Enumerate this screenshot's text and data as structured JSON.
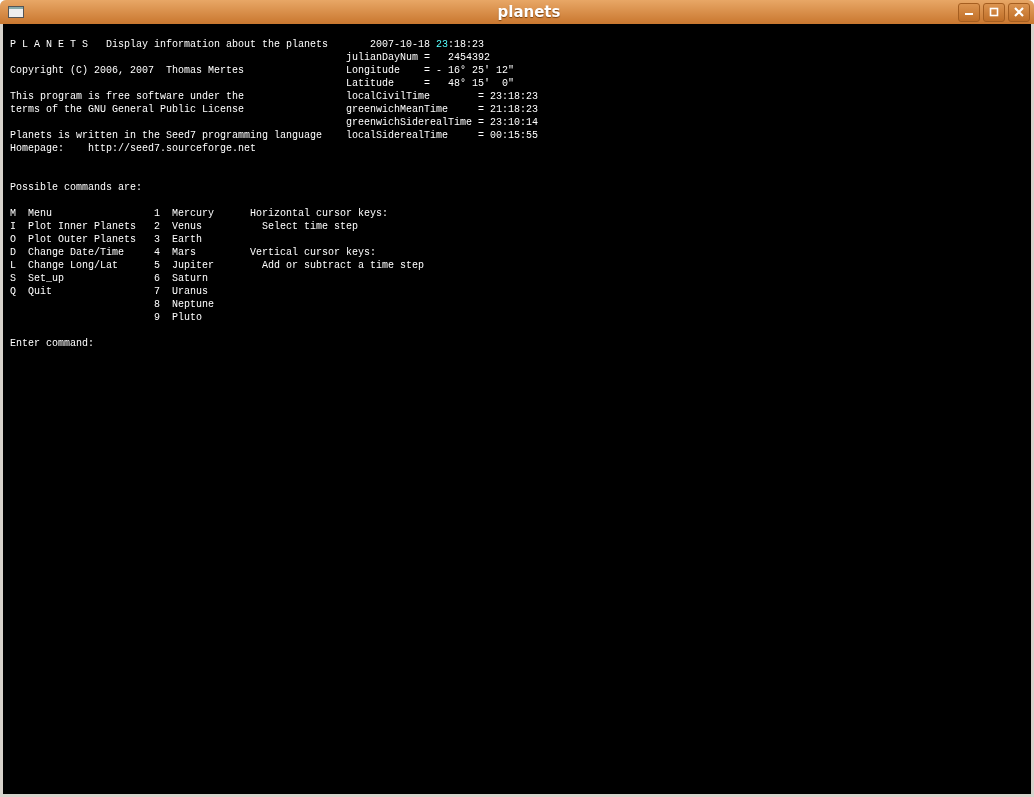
{
  "window": {
    "title": "planets"
  },
  "header": {
    "title": "P L A N E T S",
    "subtitle": "Display information about the planets"
  },
  "about": [
    {
      "text": "Copyright (C) 2006, 2007  Thomas Mertes"
    },
    {
      "text": "This program is free software under the"
    },
    {
      "text": "terms of the GNU General Public License"
    },
    {
      "text": "Planets is written in the Seed7 programming language"
    },
    {
      "text": "Homepage:    http://seed7.sourceforge.net"
    }
  ],
  "datetime": {
    "date": "2007-10-18",
    "time_parts": [
      {
        "text": "23",
        "selected": true
      },
      {
        "text": ":18:23",
        "selected": false
      }
    ]
  },
  "readings": [
    {
      "text": "julianDayNum =   2454392"
    },
    {
      "text": "Longitude    = - 16° 25' 12\""
    },
    {
      "text": "Latitude     =   48° 15'  0\""
    },
    {
      "text": "localCivilTime        = 23:18:23"
    },
    {
      "text": "greenwichMeanTime     = 21:18:23"
    },
    {
      "text": "greenwichSiderealTime = 23:10:14"
    },
    {
      "text": "localSiderealTime     = 00:15:55"
    }
  ],
  "commands_heading": "Possible commands are:",
  "commands": [
    {
      "key": "M",
      "label": "Menu"
    },
    {
      "key": "I",
      "label": "Plot Inner Planets"
    },
    {
      "key": "O",
      "label": "Plot Outer Planets"
    },
    {
      "key": "D",
      "label": "Change Date/Time"
    },
    {
      "key": "L",
      "label": "Change Long/Lat"
    },
    {
      "key": "S",
      "label": "Set_up"
    },
    {
      "key": "Q",
      "label": "Quit"
    }
  ],
  "planets": [
    {
      "key": "1",
      "name": "Mercury"
    },
    {
      "key": "2",
      "name": "Venus"
    },
    {
      "key": "3",
      "name": "Earth"
    },
    {
      "key": "4",
      "name": "Mars"
    },
    {
      "key": "5",
      "name": "Jupiter"
    },
    {
      "key": "6",
      "name": "Saturn"
    },
    {
      "key": "7",
      "name": "Uranus"
    },
    {
      "key": "8",
      "name": "Neptune"
    },
    {
      "key": "9",
      "name": "Pluto"
    }
  ],
  "help": [
    {
      "heading": "Horizontal cursor keys:",
      "text": "Select time step"
    },
    {
      "heading": "Vertical cursor keys:",
      "text": "Add or subtract a time step"
    }
  ],
  "prompt": "Enter command:"
}
